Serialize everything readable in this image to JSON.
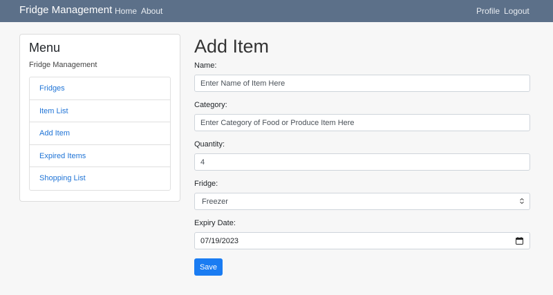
{
  "navbar": {
    "brand": "Fridge Management",
    "links": [
      "Home",
      "About"
    ],
    "right_links": [
      "Profile",
      "Logout"
    ]
  },
  "sidebar": {
    "title": "Menu",
    "subtitle": "Fridge Management",
    "items": [
      "Fridges",
      "Item List",
      "Add Item",
      "Expired Items",
      "Shopping List"
    ]
  },
  "form": {
    "title": "Add Item",
    "name_label": "Name:",
    "name_placeholder": "Enter Name of Item Here",
    "category_label": "Category:",
    "category_placeholder": "Enter Category of Food or Produce Item Here",
    "quantity_label": "Quantity:",
    "quantity_value": "4",
    "fridge_label": "Fridge:",
    "fridge_value": "Freezer",
    "expiry_label": "Expiry Date:",
    "expiry_value": "07/19/2023",
    "save_label": "Save"
  },
  "colors": {
    "navbar": "#5c7089",
    "link": "#1e73d6",
    "primary_button": "#1a7cf2"
  }
}
